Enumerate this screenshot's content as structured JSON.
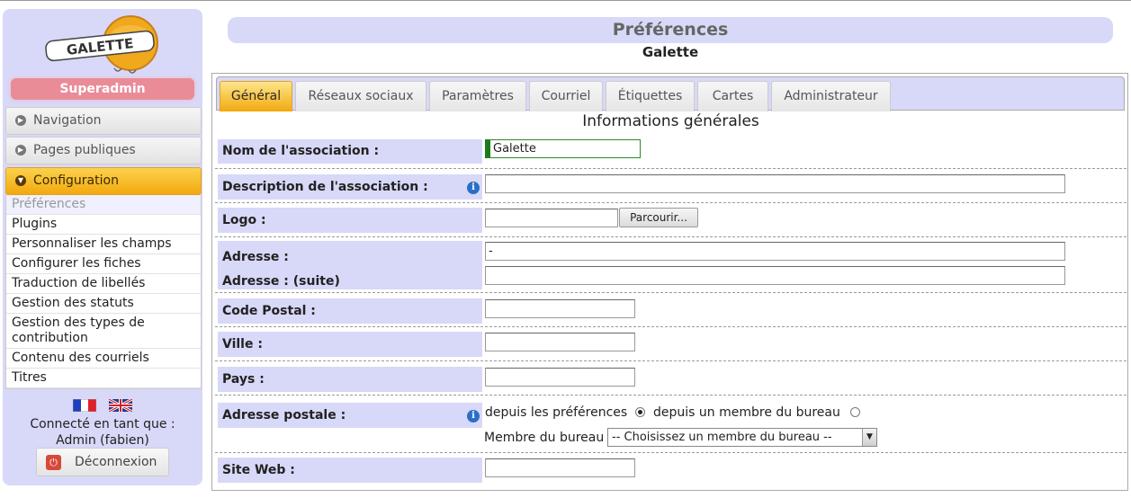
{
  "sidebar": {
    "logo_text": "GALETTE",
    "role_badge": "Superadmin",
    "nav": [
      {
        "label": "Navigation"
      },
      {
        "label": "Pages publiques"
      },
      {
        "label": "Configuration"
      }
    ],
    "submenu": [
      {
        "label": "Préférences"
      },
      {
        "label": "Plugins"
      },
      {
        "label": "Personnaliser les champs"
      },
      {
        "label": "Configurer les fiches"
      },
      {
        "label": "Traduction de libellés"
      },
      {
        "label": "Gestion des statuts"
      },
      {
        "label": "Gestion des types de contribution"
      },
      {
        "label": "Contenu des courriels"
      },
      {
        "label": "Titres"
      }
    ],
    "connected_as": "Connecté en tant que :",
    "user": "Admin (fabien)",
    "logout": "Déconnexion"
  },
  "header": {
    "title": "Préférences",
    "subtitle": "Galette"
  },
  "tabs": [
    {
      "label": "Général"
    },
    {
      "label": "Réseaux sociaux"
    },
    {
      "label": "Paramètres"
    },
    {
      "label": "Courriel"
    },
    {
      "label": "Étiquettes"
    },
    {
      "label": "Cartes"
    },
    {
      "label": "Administrateur"
    }
  ],
  "section_title": "Informations générales",
  "form": {
    "name_label": "Nom de l'association :",
    "name_value": "Galette",
    "desc_label": "Description de l'association :",
    "desc_value": "",
    "logo_label": "Logo :",
    "browse_label": "Parcourir...",
    "address_label": "Adresse :",
    "address_value": "-",
    "address2_label": "Adresse : (suite)",
    "address2_value": "",
    "zip_label": "Code Postal :",
    "zip_value": "",
    "city_label": "Ville :",
    "city_value": "",
    "country_label": "Pays :",
    "country_value": "",
    "postal_label": "Adresse postale :",
    "postal_option1": "depuis les préférences",
    "postal_option2": "depuis un membre du bureau",
    "postal_selected": "depuis les préférences",
    "board_member_label": "Membre du bureau",
    "board_member_select": "-- Choisissez un membre du bureau --",
    "website_label": "Site Web :",
    "website_value": ""
  },
  "colors": {
    "lavender": "#d8d8f8",
    "accent_orange": "#f3a90e",
    "badge_pink": "#e98c98",
    "info_blue": "#2a6fc7"
  }
}
